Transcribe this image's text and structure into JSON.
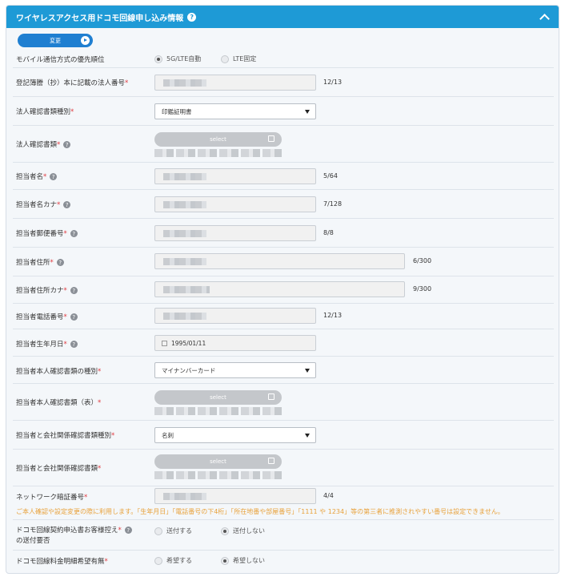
{
  "header": {
    "title": "ワイヤレスアクセス用ドコモ回線申し込み情報",
    "help_glyph": "?"
  },
  "change_button": "変更",
  "rows": {
    "priority": {
      "label": "モバイル通信方式の優先順位",
      "options": [
        "5G/LTE自動",
        "LTE固定"
      ],
      "selected": 0
    },
    "corp_no": {
      "label": "登記簿謄（抄）本に記載の法人番号",
      "count": "12/13"
    },
    "corp_doc_type": {
      "label": "法人確認書類種別",
      "value": "印鑑証明書"
    },
    "corp_doc": {
      "label": "法人確認書類",
      "button": "select"
    },
    "person_name": {
      "label": "担当者名",
      "count": "5/64"
    },
    "person_kana": {
      "label": "担当者名カナ",
      "count": "7/128"
    },
    "zip": {
      "label": "担当者郵便番号",
      "count": "8/8"
    },
    "address": {
      "label": "担当者住所",
      "count": "6/300"
    },
    "address_kana": {
      "label": "担当者住所カナ",
      "count": "9/300"
    },
    "phone": {
      "label": "担当者電話番号",
      "count": "12/13"
    },
    "birthday": {
      "label": "担当者生年月日",
      "value": "1995/01/11"
    },
    "id_doc_type": {
      "label": "担当者本人確認書類の種別",
      "value": "マイナンバーカード"
    },
    "id_doc_front": {
      "label": "担当者本人確認書類（表）",
      "button": "select"
    },
    "relation_doc_type": {
      "label": "担当者と会社関係確認書類種別",
      "value": "名刺"
    },
    "relation_doc": {
      "label": "担当者と会社関係確認書類",
      "button": "select"
    },
    "pin": {
      "label": "ネットワーク暗証番号",
      "count": "4/4",
      "warning": "ご本人確認や設定変更の際に利用します。「生年月日」「電話番号の下4桁」「所在地番や部屋番号」「1111 や 1234」等の第三者に推測されやすい番号は設定できません。"
    },
    "copy_send": {
      "label_line1": "ドコモ回線契約申込書お客様控え",
      "label_line2": "の送付要否",
      "options": [
        "送付する",
        "送付しない"
      ],
      "selected": 1
    },
    "detail_bill": {
      "label": "ドコモ回線料金明細希望有無",
      "options": [
        "希望する",
        "希望しない"
      ],
      "selected": 1
    }
  },
  "required_mark": "*"
}
